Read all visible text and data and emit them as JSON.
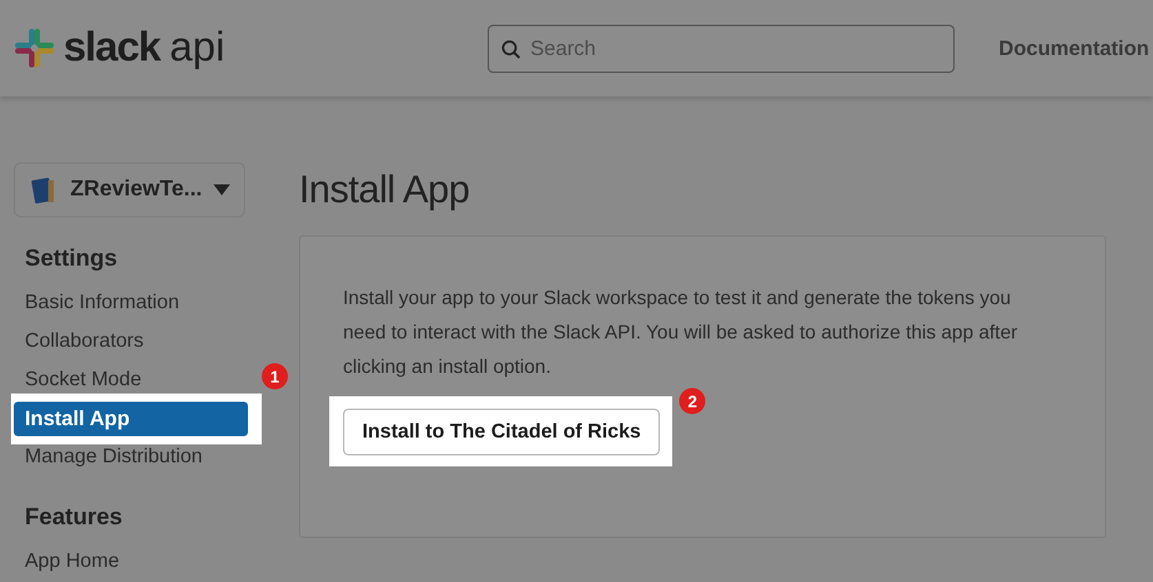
{
  "header": {
    "logo": {
      "brand": "slack",
      "product": "api"
    },
    "search": {
      "placeholder": "Search"
    },
    "nav_links": [
      "Documentation"
    ]
  },
  "sidebar": {
    "app_selector": {
      "name": "ZReviewTe..."
    },
    "sections": [
      {
        "heading": "Settings",
        "items": [
          {
            "label": "Basic Information",
            "selected": false,
            "highlighted": false
          },
          {
            "label": "Collaborators",
            "selected": false,
            "highlighted": false
          },
          {
            "label": "Socket Mode",
            "selected": false,
            "highlighted": false
          },
          {
            "label": "Install App",
            "selected": true,
            "highlighted": true,
            "callout": "1"
          },
          {
            "label": "Manage Distribution",
            "selected": false,
            "highlighted": false
          }
        ]
      },
      {
        "heading": "Features",
        "items": [
          {
            "label": "App Home",
            "selected": false,
            "highlighted": false
          }
        ]
      }
    ]
  },
  "main": {
    "title": "Install App",
    "panel": {
      "description": "Install your app to your Slack workspace to test it and generate the tokens you need to interact with the Slack API. You will be asked to authorize this app after clicking an install option.",
      "button": {
        "label": "Install to The Citadel of Ricks",
        "highlighted": true,
        "callout": "2"
      }
    }
  }
}
